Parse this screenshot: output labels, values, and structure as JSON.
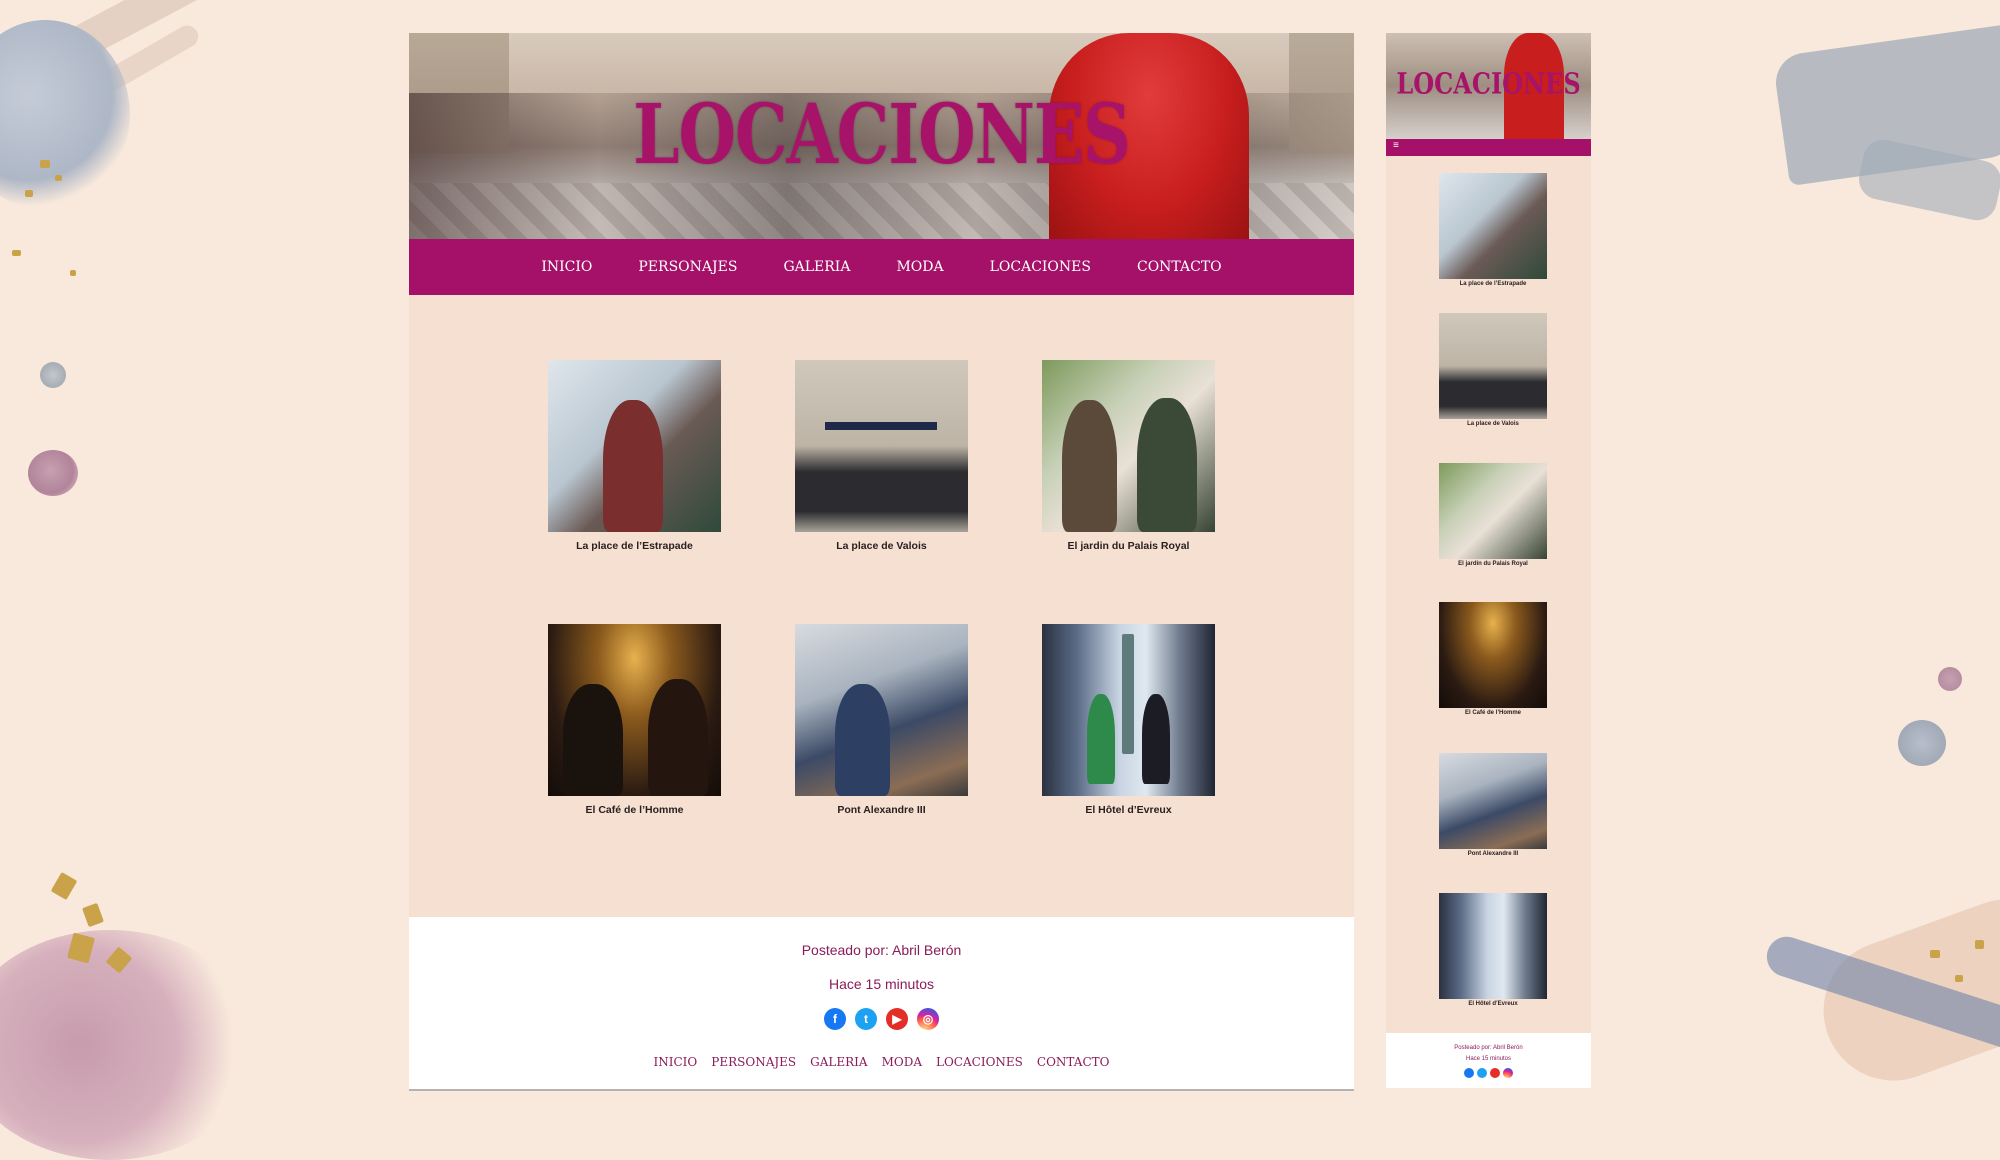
{
  "hero": {
    "title": "LOCACIONES"
  },
  "nav": [
    "INICIO",
    "PERSONAJES",
    "GALERIA",
    "MODA",
    "LOCACIONES",
    "CONTACTO"
  ],
  "locations": [
    {
      "caption": "La place de l’Estrapade",
      "image": "woman-taking-selfie-photo"
    },
    {
      "caption": "La place de Valois",
      "image": "galerie-patrick-fourtin-storefront-photo"
    },
    {
      "caption": "El jardin du Palais Royal",
      "image": "two-women-in-garden-photo"
    },
    {
      "caption": "El Café de l’Homme",
      "image": "couple-dining-eiffel-tower-night-photo"
    },
    {
      "caption": "Pont Alexandre III",
      "image": "film-set-photo"
    },
    {
      "caption": "El Hôtel d’Evreux",
      "image": "balcony-vendome-column-photo"
    }
  ],
  "footer": {
    "posted_by": "Posteado por: Abril Berón",
    "time_ago": "Hace 15 minutos",
    "social": [
      {
        "icon": "facebook-icon",
        "glyph": "f",
        "color": "#1877f2"
      },
      {
        "icon": "twitter-icon",
        "glyph": "t",
        "color": "#1da1f2"
      },
      {
        "icon": "youtube-icon",
        "glyph": "▶",
        "color": "#e52d27"
      },
      {
        "icon": "instagram-icon",
        "glyph": "◎",
        "color": "#d6249f"
      }
    ],
    "nav": [
      "INICIO",
      "PERSONAJES",
      "GALERIA",
      "MODA",
      "LOCACIONES",
      "CONTACTO"
    ]
  },
  "mobile": {
    "title": "LOCACIONES",
    "menu_icon": "≡",
    "locations": [
      "La place de l’Estrapade",
      "La place de Valois",
      "El jardin du Palais Royal",
      "El Café de l’Homme",
      "Pont Alexandre III",
      "El Hôtel d’Evreux"
    ],
    "posted_by": "Posteado por: Abril Berón",
    "time_ago": "Hace 15 minutos"
  },
  "colors": {
    "accent": "#a51168",
    "background": "#f9e9dc",
    "panel": "#f5e0d2",
    "footer_text": "#8a1c59"
  }
}
